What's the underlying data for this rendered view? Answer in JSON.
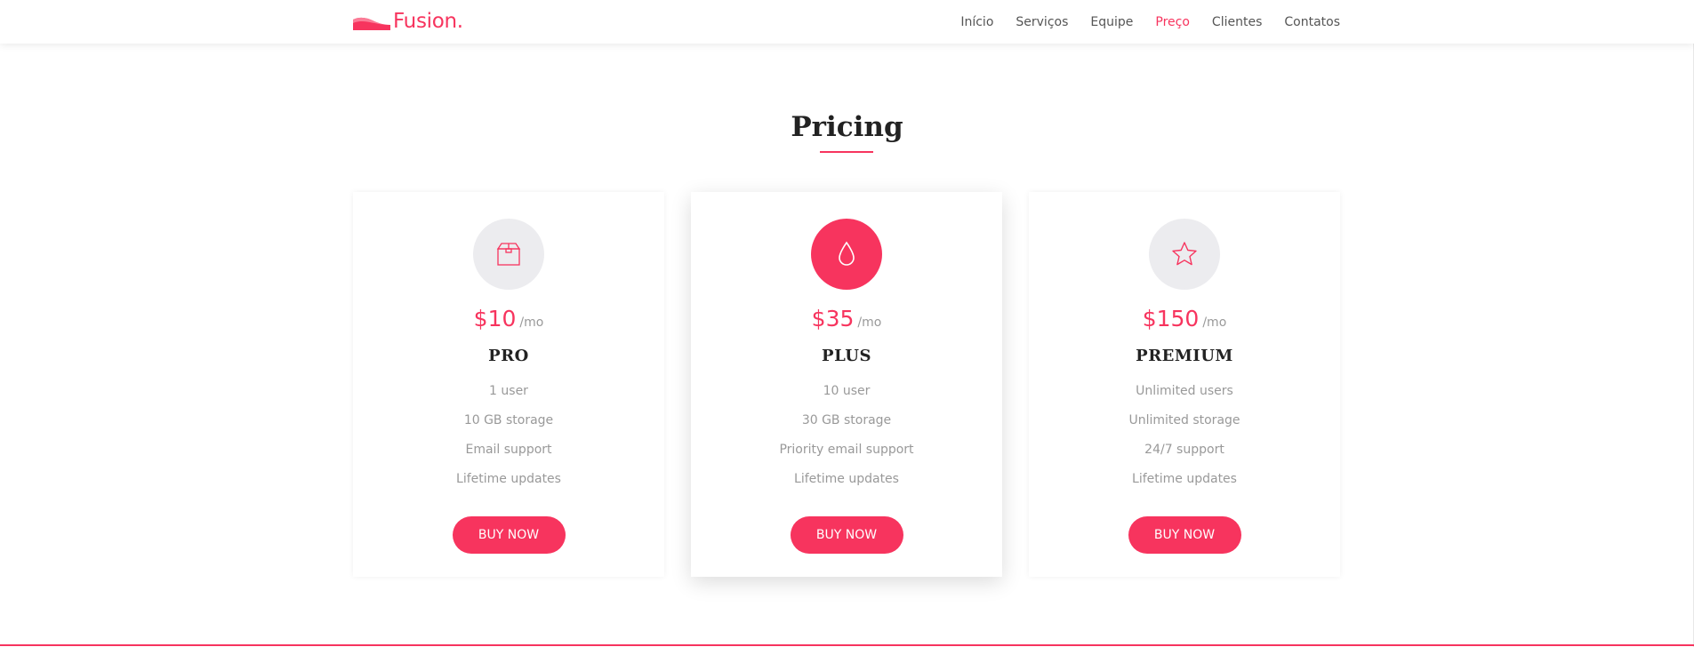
{
  "brand": {
    "name": "Fusion.",
    "accent": "#f7345e"
  },
  "nav": {
    "items": [
      {
        "label": "Início",
        "active": false
      },
      {
        "label": "Serviços",
        "active": false
      },
      {
        "label": "Equipe",
        "active": false
      },
      {
        "label": "Preço",
        "active": true
      },
      {
        "label": "Clientes",
        "active": false
      },
      {
        "label": "Contatos",
        "active": false
      }
    ]
  },
  "pricing": {
    "title": "Pricing",
    "plans": [
      {
        "icon": "box-icon",
        "price": "$10",
        "period": "/mo",
        "name": "PRO",
        "features": [
          "1 user",
          "10 GB storage",
          "Email support",
          "Lifetime updates"
        ],
        "button_label": "BUY NOW",
        "featured": false
      },
      {
        "icon": "droplet-icon",
        "price": "$35",
        "period": "/mo",
        "name": "PLUS",
        "features": [
          "10 user",
          "30 GB storage",
          "Priority email support",
          "Lifetime updates"
        ],
        "button_label": "BUY NOW",
        "featured": true
      },
      {
        "icon": "star-icon",
        "price": "$150",
        "period": "/mo",
        "name": "PREMIUM",
        "features": [
          "Unlimited users",
          "Unlimited storage",
          "24/7 support",
          "Lifetime updates"
        ],
        "button_label": "BUY NOW",
        "featured": false
      }
    ]
  }
}
